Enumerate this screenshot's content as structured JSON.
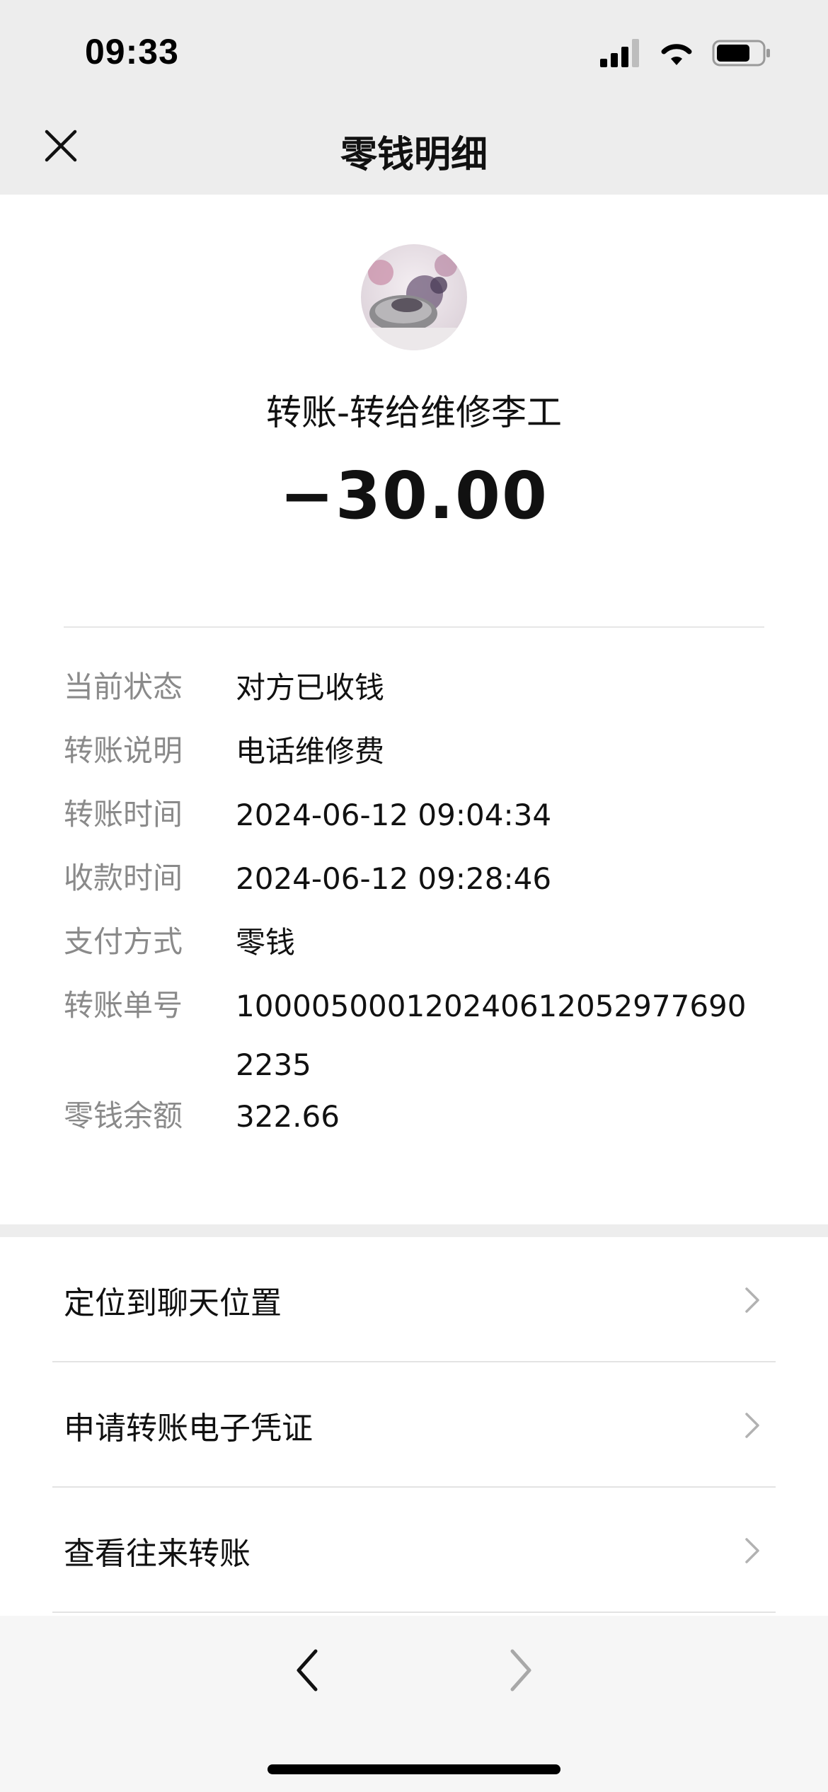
{
  "status_bar": {
    "time": "09:33",
    "signal_icon": "cellular-signal-icon",
    "wifi_icon": "wifi-icon",
    "battery_icon": "battery-icon"
  },
  "nav": {
    "title": "零钱明细",
    "close_icon": "close-icon"
  },
  "transaction": {
    "avatar_icon": "avatar",
    "title": "转账-转给维修李工",
    "amount": "−30.00"
  },
  "details": [
    {
      "label": "当前状态",
      "value": "对方已收钱"
    },
    {
      "label": "转账说明",
      "value": "电话维修费"
    },
    {
      "label": "转账时间",
      "value": "2024-06-12 09:04:34"
    },
    {
      "label": "收款时间",
      "value": "2024-06-12 09:28:46"
    },
    {
      "label": "支付方式",
      "value": "零钱"
    },
    {
      "label": "转账单号",
      "value": "100005000120240612052977690223​5"
    },
    {
      "label": "零钱余额",
      "value": "322.66"
    }
  ],
  "actions": [
    {
      "label": "定位到聊天位置",
      "icon": "chevron-right-icon"
    },
    {
      "label": "申请转账电子凭证",
      "icon": "chevron-right-icon"
    },
    {
      "label": "查看往来转账",
      "icon": "chevron-right-icon"
    }
  ],
  "browser_nav": {
    "back_icon": "chevron-left-icon",
    "forward_icon": "chevron-right-icon"
  },
  "colors": {
    "background": "#ededed",
    "card": "#ffffff",
    "label_gray": "#8a8a8a",
    "text": "#111111"
  }
}
